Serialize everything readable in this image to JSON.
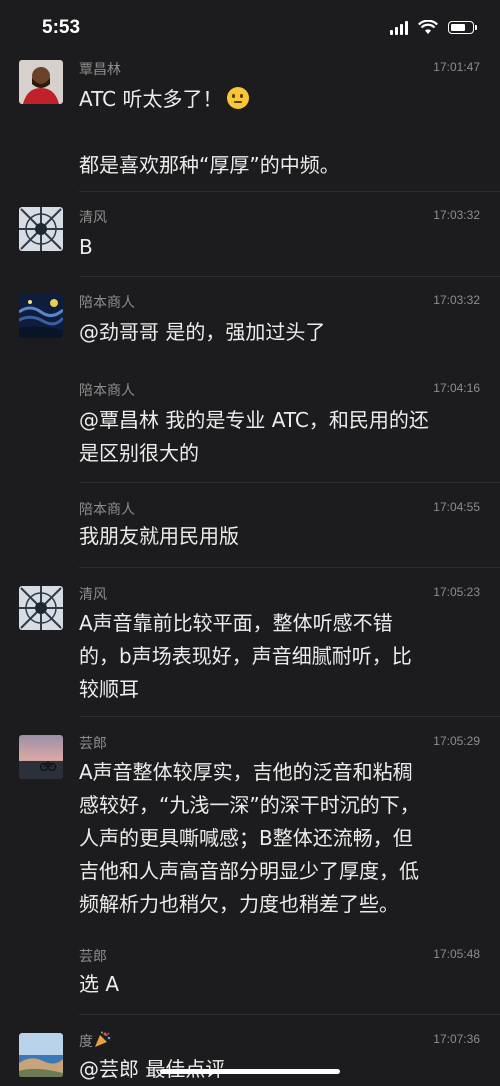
{
  "status": {
    "time": "5:53"
  },
  "messages": [
    {
      "sender": "覃昌林",
      "time": "17:01:47",
      "lines": [
        "ATC 听太多了！",
        "",
        "都是喜欢那种“厚厚”的中频。"
      ]
    },
    {
      "sender": "清风",
      "time": "17:03:32",
      "lines": [
        "B"
      ]
    },
    {
      "sender": "陪本商人",
      "time": "17:03:32",
      "lines": [
        "@劲哥哥 是的，强加过头了"
      ]
    },
    {
      "sender": "陪本商人",
      "time": "17:04:16",
      "lines": [
        "@覃昌林 我的是专业 ATC，和民用的还",
        "是区别很大的"
      ]
    },
    {
      "sender": "陪本商人",
      "time": "17:04:55",
      "lines": [
        "我朋友就用民用版"
      ]
    },
    {
      "sender": "清风",
      "time": "17:05:23",
      "lines": [
        "A声音靠前比较平面，整体听感不错",
        "的，b声场表现好，声音细腻耐听，比",
        "较顺耳"
      ]
    },
    {
      "sender": "芸郎",
      "time": "17:05:29",
      "lines": [
        "A声音整体较厚实，吉他的泛音和粘稠",
        "感较好，“九浅一深”的深干时沉的下，",
        "人声的更具嘶喊感；B整体还流畅，但",
        "吉他和人声高音部分明显少了厚度，低",
        "频解析力也稍欠，力度也稍差了些。"
      ]
    },
    {
      "sender": "芸郎",
      "time": "17:05:48",
      "lines": [
        "选 A"
      ]
    },
    {
      "sender": "度",
      "time": "17:07:36",
      "lines": [
        "@芸郎 最佳点评"
      ]
    }
  ],
  "icons": {
    "emoji_thinking": "thinking-face-emoji",
    "sender_emoji": "party-popper-emoji"
  }
}
